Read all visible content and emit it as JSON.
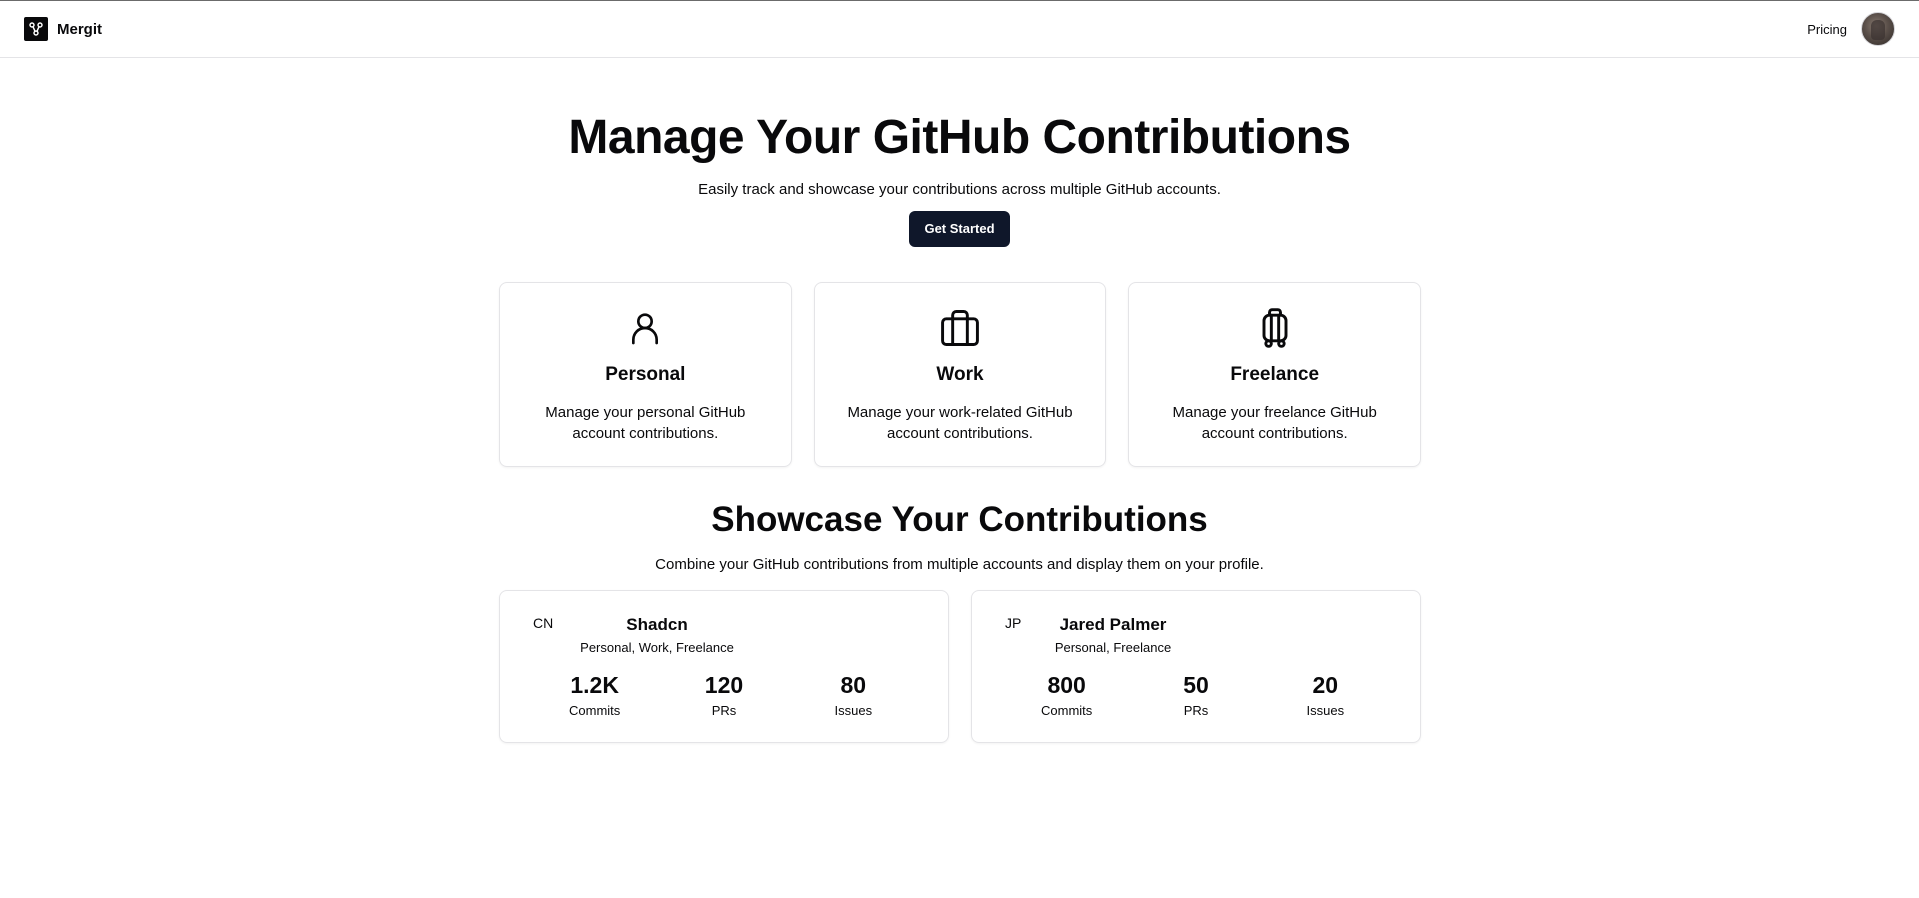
{
  "header": {
    "brand": "Mergit",
    "nav_pricing": "Pricing"
  },
  "hero": {
    "title": "Manage Your GitHub Contributions",
    "subtitle": "Easily track and showcase your contributions across multiple GitHub accounts.",
    "cta": "Get Started"
  },
  "features": [
    {
      "icon": "user-icon",
      "title": "Personal",
      "description": "Manage your personal GitHub account contributions."
    },
    {
      "icon": "briefcase-icon",
      "title": "Work",
      "description": "Manage your work-related GitHub account contributions."
    },
    {
      "icon": "luggage-icon",
      "title": "Freelance",
      "description": "Manage your freelance GitHub account contributions."
    }
  ],
  "showcase": {
    "title": "Showcase Your Contributions",
    "subtitle": "Combine your GitHub contributions from multiple accounts and display them on your profile."
  },
  "profiles": [
    {
      "initials": "CN",
      "name": "Shadcn",
      "tags": "Personal, Work, Freelance",
      "stats": [
        {
          "value": "1.2K",
          "label": "Commits"
        },
        {
          "value": "120",
          "label": "PRs"
        },
        {
          "value": "80",
          "label": "Issues"
        }
      ]
    },
    {
      "initials": "JP",
      "name": "Jared Palmer",
      "tags": "Personal, Freelance",
      "stats": [
        {
          "value": "800",
          "label": "Commits"
        },
        {
          "value": "50",
          "label": "PRs"
        },
        {
          "value": "20",
          "label": "Issues"
        }
      ]
    }
  ],
  "colors": {
    "primary_button": "#0f172a",
    "border": "#e4e4e7",
    "text": "#09090b"
  }
}
